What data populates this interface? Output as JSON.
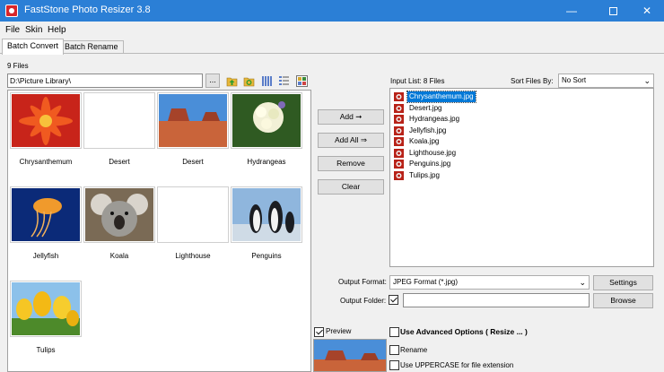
{
  "window": {
    "title": "FastStone Photo Resizer 3.8"
  },
  "menu": [
    "File",
    "Skin",
    "Help"
  ],
  "tabs": [
    "Batch Convert",
    "Batch Rename"
  ],
  "files_count": "9 Files",
  "path": {
    "value": "D:\\Picture Library\\",
    "browse_label": "..."
  },
  "thumbnails": [
    {
      "name": "Chrysanthemum",
      "icon": "flower-photo"
    },
    {
      "name": "Desert",
      "icon": "blank-photo"
    },
    {
      "name": "Desert",
      "icon": "desert-photo"
    },
    {
      "name": "Hydrangeas",
      "icon": "hydrangea-photo"
    },
    {
      "name": "Jellyfish",
      "icon": "jellyfish-photo"
    },
    {
      "name": "Koala",
      "icon": "koala-photo"
    },
    {
      "name": "Lighthouse",
      "icon": "blank-photo"
    },
    {
      "name": "Penguins",
      "icon": "penguins-photo"
    },
    {
      "name": "Tulips",
      "icon": "tulips-photo"
    }
  ],
  "actions": {
    "add": "Add",
    "add_all": "Add All",
    "remove": "Remove",
    "clear": "Clear"
  },
  "input_list": {
    "label": "Input List:",
    "count": "8 Files",
    "files": [
      "Chrysanthemum.jpg",
      "Desert.jpg",
      "Hydrangeas.jpg",
      "Jellyfish.jpg",
      "Koala.jpg",
      "Lighthouse.jpg",
      "Penguins.jpg",
      "Tulips.jpg"
    ],
    "selected": "Chrysanthemum.jpg"
  },
  "sort": {
    "label": "Sort Files By:",
    "value": "No Sort"
  },
  "output": {
    "format_label": "Output Format:",
    "format_value": "JPEG Format (*.jpg)",
    "settings_label": "Settings",
    "folder_label": "Output Folder:",
    "folder_checked": true,
    "folder_value": "",
    "browse_label": "Browse"
  },
  "preview": {
    "label": "Preview",
    "checked": true
  },
  "options": {
    "advanced": "Use Advanced Options ( Resize ... )",
    "rename": "Rename",
    "uppercase": "Use UPPERCASE for file extension"
  },
  "colors": {
    "titlebar": "#2b7fd6",
    "selection": "#0078d7"
  }
}
